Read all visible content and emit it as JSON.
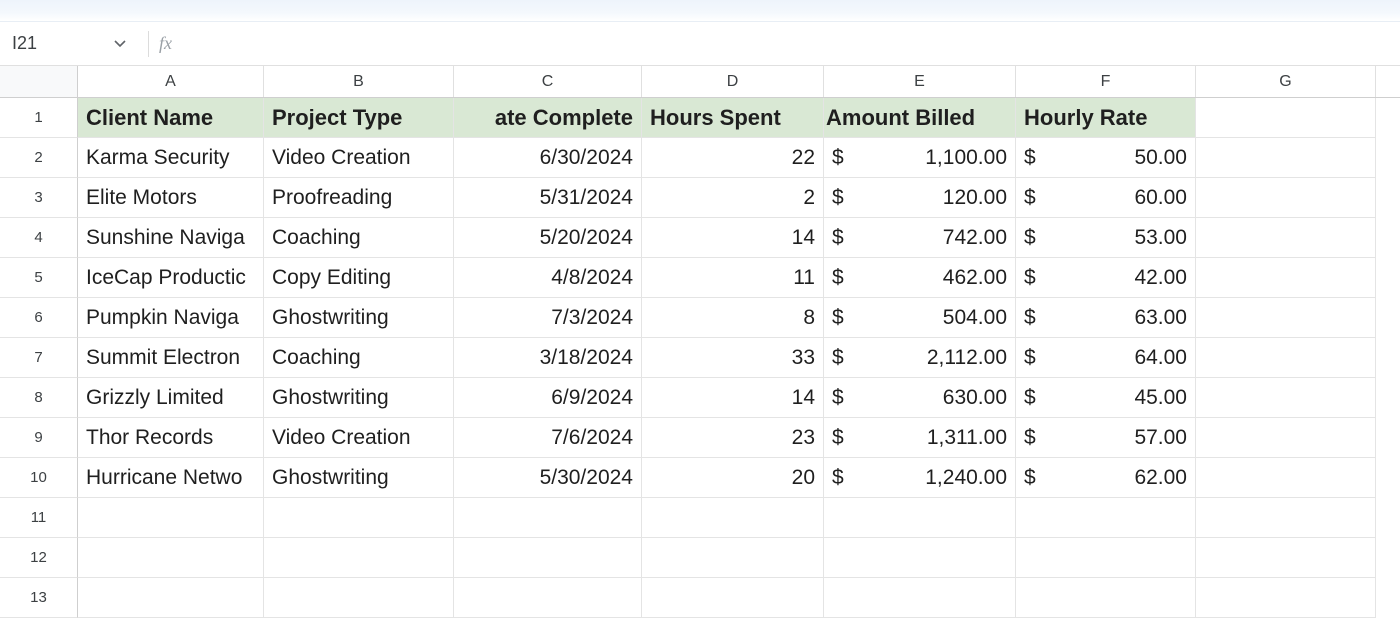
{
  "nameBox": {
    "value": "I21"
  },
  "formulaBar": {
    "fx": "fx",
    "value": ""
  },
  "columns": [
    "A",
    "B",
    "C",
    "D",
    "E",
    "F",
    "G"
  ],
  "rowNumbers": [
    "1",
    "2",
    "3",
    "4",
    "5",
    "6",
    "7",
    "8",
    "9",
    "10",
    "11",
    "12",
    "13"
  ],
  "headers": {
    "A": "Client Name",
    "B": "Project Type",
    "C": "ate Complete",
    "D": "Hours Spent",
    "E": "Amount Billed",
    "F": "Hourly Rate"
  },
  "data": [
    {
      "client": "Karma Security",
      "type": "Video Creation",
      "date": "6/30/2024",
      "hours": "22",
      "amount": "1,100.00",
      "rate": "50.00"
    },
    {
      "client": "Elite Motors",
      "type": "Proofreading",
      "date": "5/31/2024",
      "hours": "2",
      "amount": "120.00",
      "rate": "60.00"
    },
    {
      "client": "Sunshine Naviga",
      "type": "Coaching",
      "date": "5/20/2024",
      "hours": "14",
      "amount": "742.00",
      "rate": "53.00"
    },
    {
      "client": "IceCap Productic",
      "type": "Copy Editing",
      "date": "4/8/2024",
      "hours": "11",
      "amount": "462.00",
      "rate": "42.00"
    },
    {
      "client": "Pumpkin Naviga",
      "type": "Ghostwriting",
      "date": "7/3/2024",
      "hours": "8",
      "amount": "504.00",
      "rate": "63.00"
    },
    {
      "client": "Summit Electron",
      "type": "Coaching",
      "date": "3/18/2024",
      "hours": "33",
      "amount": "2,112.00",
      "rate": "64.00"
    },
    {
      "client": "Grizzly Limited",
      "type": "Ghostwriting",
      "date": "6/9/2024",
      "hours": "14",
      "amount": "630.00",
      "rate": "45.00"
    },
    {
      "client": "Thor Records",
      "type": "Video Creation",
      "date": "7/6/2024",
      "hours": "23",
      "amount": "1,311.00",
      "rate": "57.00"
    },
    {
      "client": "Hurricane Netwo",
      "type": "Ghostwriting",
      "date": "5/30/2024",
      "hours": "20",
      "amount": "1,240.00",
      "rate": "62.00"
    }
  ],
  "currencySymbol": "$"
}
